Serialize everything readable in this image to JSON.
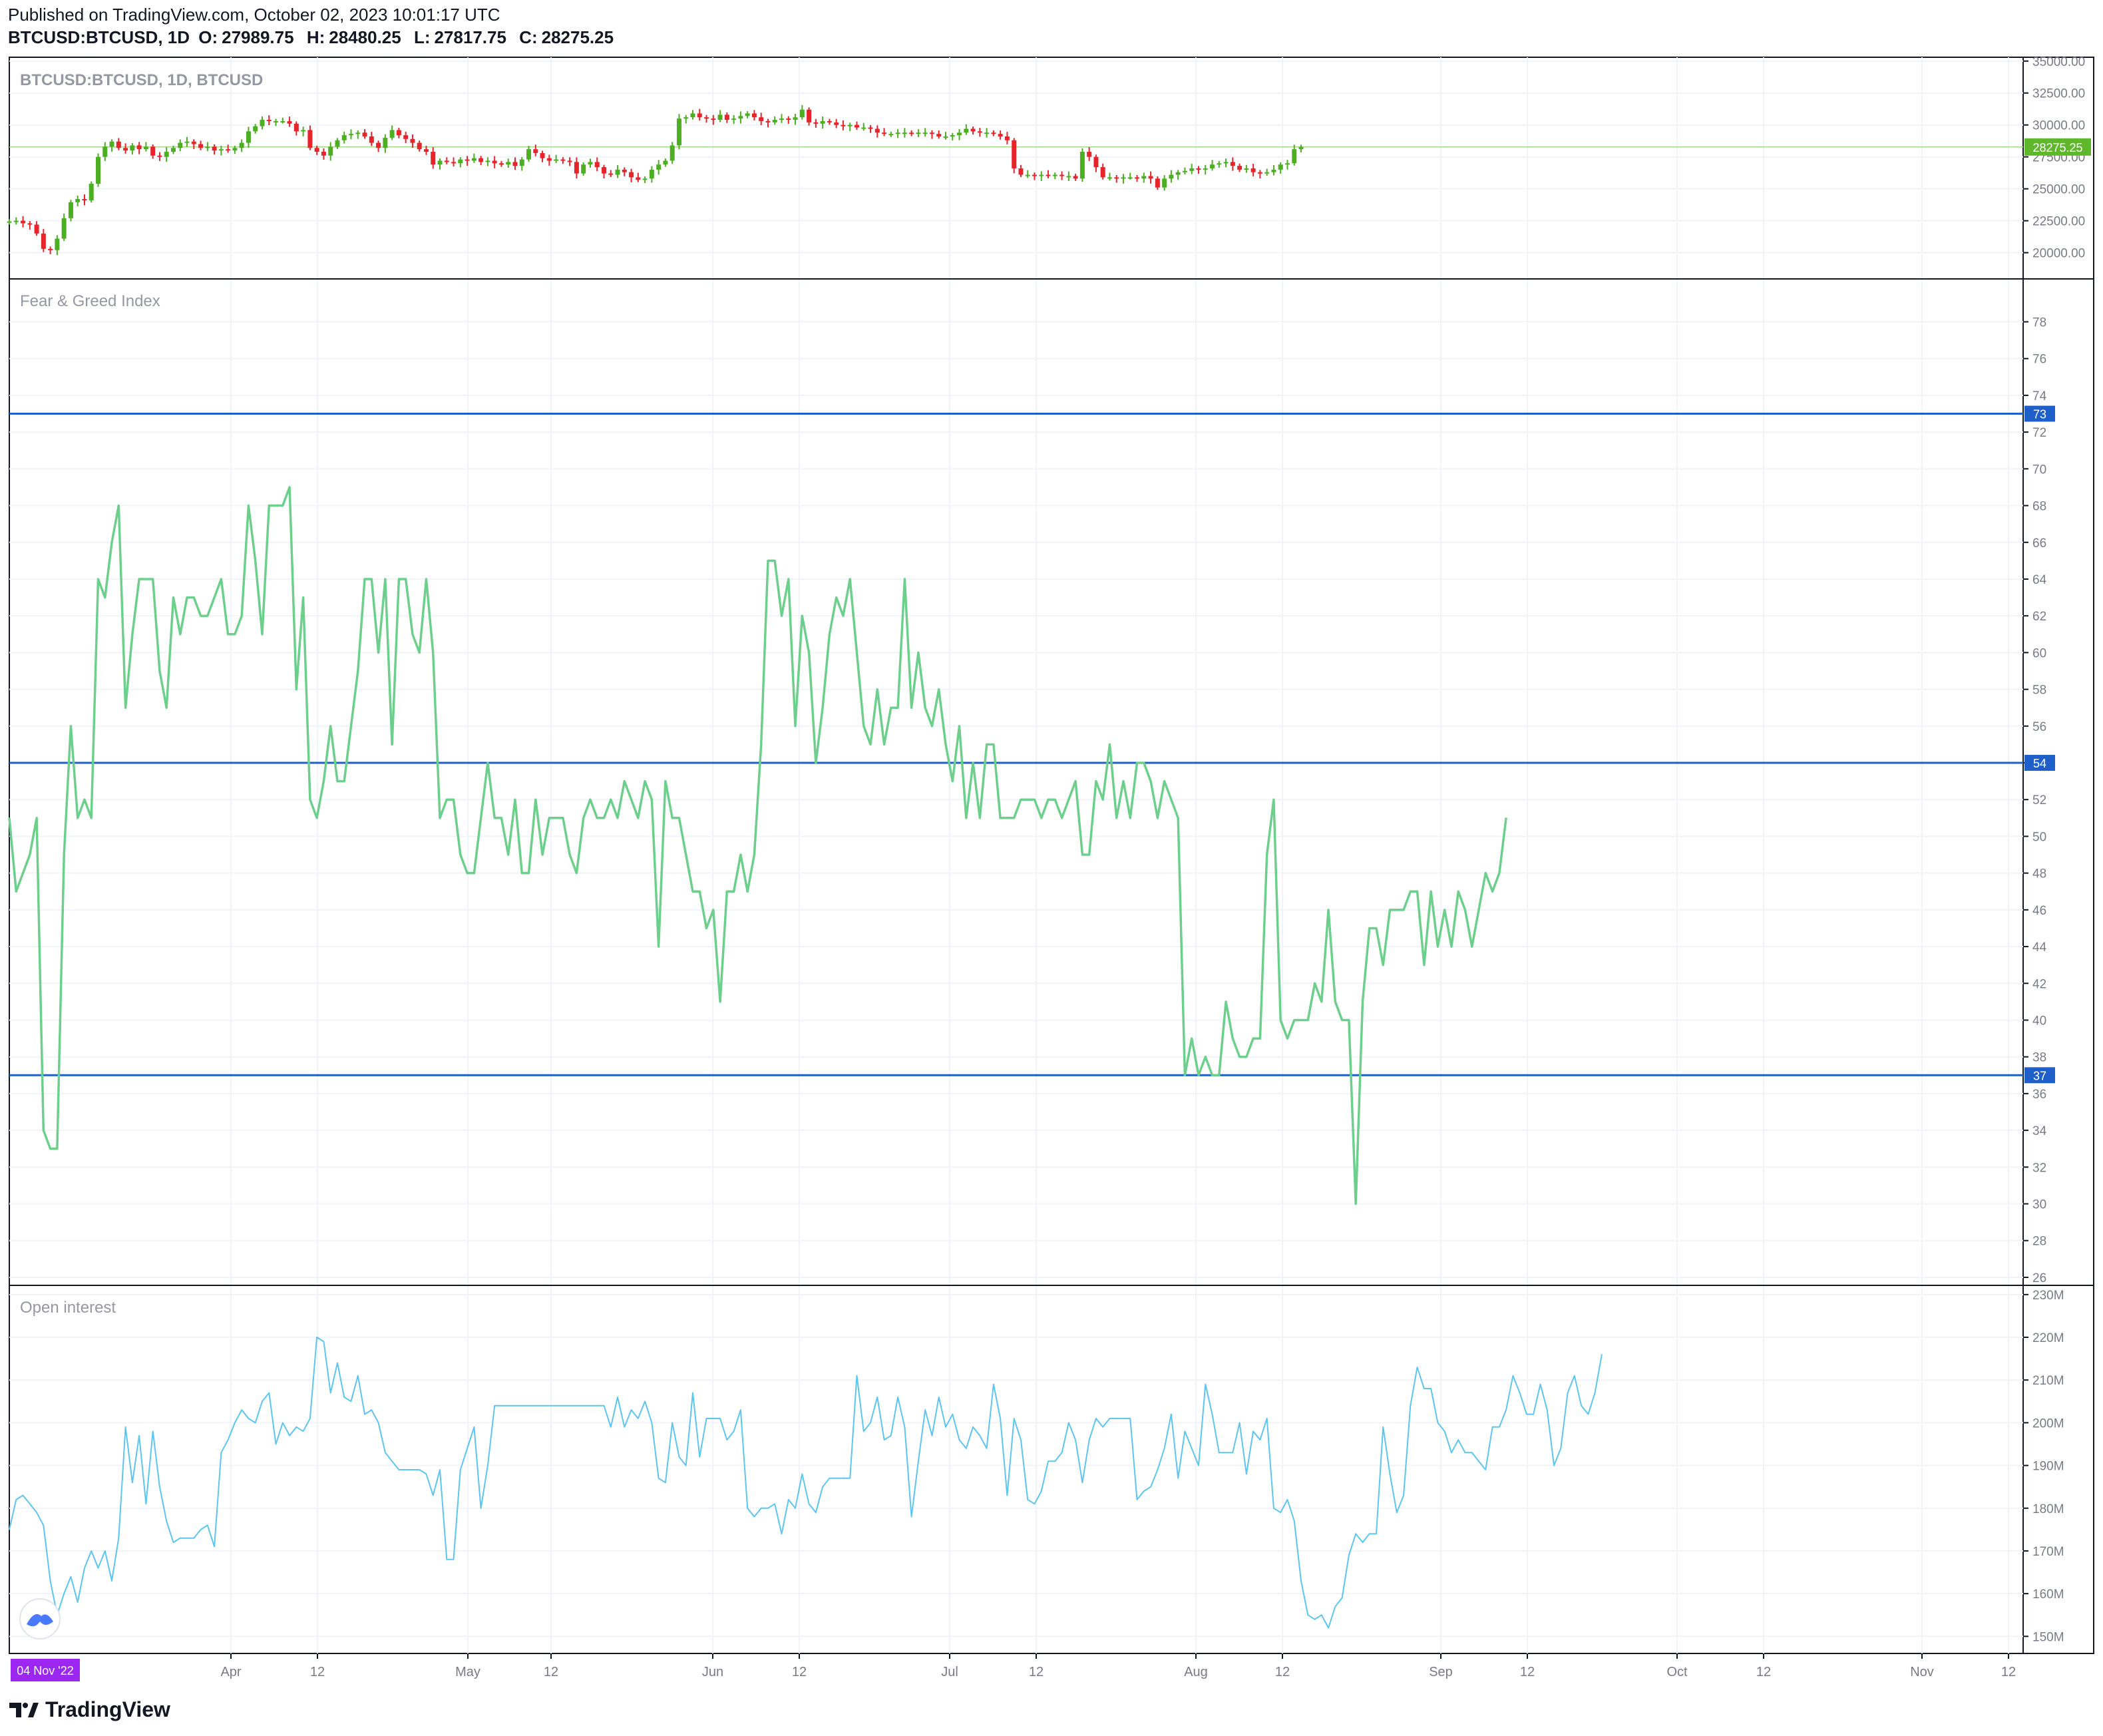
{
  "header": {
    "published": "Published on TradingView.com, October 02, 2023 10:01:17 UTC",
    "symbol": "BTCUSD:BTCUSD, 1D",
    "o_label": "O:",
    "o": "27989.75",
    "h_label": "H:",
    "h": "28480.25",
    "l_label": "L:",
    "l": "27817.75",
    "c_label": "C:",
    "c": "28275.25"
  },
  "footer": {
    "brand": "TradingView"
  },
  "colors": {
    "up": "#4caf22",
    "down": "#e8242b",
    "fg_line": "#6dcf8c",
    "oi_line": "#5cc5f0",
    "hline": "#1f5fc9",
    "grid": "#f0f3fa",
    "price_badge": "#5fb82c",
    "axis_text": "#787b86",
    "date_badge": "#9c27f0"
  },
  "chart_data": [
    {
      "type": "candlestick",
      "title": "BTCUSD:BTCUSD, 1D, BTCUSD",
      "y_ticks": [
        "20000.00",
        "22500.00",
        "25000.00",
        "27500.00",
        "30000.00",
        "32500.00",
        "35000.00"
      ],
      "ylim": [
        18000,
        35300
      ],
      "last_price_label": "28275.25",
      "close_series": [
        22450,
        22500,
        22300,
        22200,
        21500,
        20300,
        20200,
        21100,
        22700,
        23950,
        24200,
        24100,
        25400,
        27500,
        28300,
        28700,
        28200,
        28000,
        28400,
        28100,
        28300,
        27600,
        27500,
        27900,
        28200,
        28600,
        28700,
        28500,
        28200,
        28300,
        28000,
        28100,
        28000,
        28200,
        28600,
        29500,
        29900,
        30400,
        30300,
        30300,
        30300,
        30100,
        29500,
        29600,
        28200,
        27900,
        27600,
        28300,
        28800,
        29200,
        29300,
        29400,
        29100,
        28600,
        28200,
        29000,
        29600,
        29200,
        28900,
        28600,
        28100,
        27900,
        26900,
        27200,
        27100,
        27000,
        27300,
        27200,
        27400,
        27100,
        27200,
        27000,
        26900,
        27100,
        26800,
        27300,
        28100,
        27800,
        27400,
        27200,
        27300,
        27200,
        27100,
        26200,
        26900,
        27100,
        26700,
        26200,
        26100,
        26500,
        26300,
        25900,
        25700,
        25800,
        26500,
        26900,
        27200,
        28400,
        30500,
        30600,
        30900,
        30600,
        30500,
        30400,
        30800,
        30400,
        30500,
        30700,
        30900,
        30600,
        30300,
        30200,
        30400,
        30500,
        30400,
        30600,
        31200,
        30200,
        30100,
        30300,
        30200,
        30000,
        29900,
        30000,
        29800,
        29800,
        29700,
        29400,
        29300,
        29300,
        29400,
        29400,
        29300,
        29400,
        29400,
        29300,
        29100,
        29100,
        29200,
        29400,
        29700,
        29500,
        29400,
        29400,
        29300,
        29100,
        28800,
        26600,
        26100,
        26100,
        26000,
        26100,
        26000,
        26100,
        26000,
        26000,
        25800,
        27900,
        27500,
        26700,
        25900,
        25900,
        25800,
        25900,
        25900,
        25800,
        26000,
        25800,
        25100,
        25800,
        26100,
        26300,
        26400,
        26600,
        26500,
        26600,
        26900,
        27000,
        27100,
        26800,
        26500,
        26600,
        26300,
        26200,
        26300,
        26500,
        26900,
        27000,
        28100,
        28275.25
      ]
    },
    {
      "type": "line",
      "title": "Fear & Greed Index",
      "y_ticks": [
        26,
        28,
        30,
        32,
        34,
        36,
        38,
        40,
        42,
        44,
        46,
        48,
        50,
        52,
        54,
        56,
        58,
        60,
        62,
        64,
        66,
        68,
        70,
        72,
        74,
        76,
        78
      ],
      "ylim": [
        25.6,
        80.3
      ],
      "hlines": [
        73,
        54,
        37
      ],
      "values": [
        51,
        47,
        48,
        49,
        51,
        34,
        33,
        33,
        49,
        56,
        51,
        52,
        51,
        64,
        63,
        66,
        68,
        57,
        61,
        64,
        64,
        64,
        59,
        57,
        63,
        61,
        63,
        63,
        62,
        62,
        63,
        64,
        61,
        61,
        62,
        68,
        65,
        61,
        68,
        68,
        68,
        69,
        58,
        63,
        52,
        51,
        53,
        56,
        53,
        53,
        56,
        59,
        64,
        64,
        60,
        64,
        55,
        64,
        64,
        61,
        60,
        64,
        60,
        51,
        52,
        52,
        49,
        48,
        48,
        51,
        54,
        51,
        51,
        49,
        52,
        48,
        48,
        52,
        49,
        51,
        51,
        51,
        49,
        48,
        51,
        52,
        51,
        51,
        52,
        51,
        53,
        52,
        51,
        53,
        52,
        44,
        53,
        51,
        51,
        49,
        47,
        47,
        45,
        46,
        41,
        47,
        47,
        49,
        47,
        49,
        55,
        65,
        65,
        62,
        64,
        56,
        62,
        60,
        54,
        57,
        61,
        63,
        62,
        64,
        60,
        56,
        55,
        58,
        55,
        57,
        57,
        64,
        57,
        60,
        57,
        56,
        58,
        55,
        53,
        56,
        51,
        54,
        51,
        55,
        55,
        51,
        51,
        51,
        52,
        52,
        52,
        51,
        52,
        52,
        51,
        52,
        53,
        49,
        49,
        53,
        52,
        55,
        51,
        53,
        51,
        54,
        54,
        53,
        51,
        53,
        52,
        51,
        37,
        39,
        37,
        38,
        37,
        37,
        41,
        39,
        38,
        38,
        39,
        39,
        49,
        52,
        40,
        39,
        40,
        40,
        40,
        42,
        41,
        46,
        41,
        40,
        40,
        30,
        41,
        45,
        45,
        43,
        46,
        46,
        46,
        47,
        47,
        43,
        47,
        44,
        46,
        44,
        47,
        46,
        44,
        46,
        48,
        47,
        48,
        51
      ]
    },
    {
      "type": "line",
      "title": "Open interest",
      "y_ticks": [
        "150M",
        "160M",
        "170M",
        "180M",
        "190M",
        "200M",
        "210M",
        "220M",
        "230M"
      ],
      "ylim": [
        146,
        232
      ],
      "values": [
        175,
        182,
        183,
        181,
        179,
        176,
        163,
        155,
        160,
        164,
        158,
        166,
        170,
        166,
        170,
        163,
        173,
        199,
        186,
        197,
        181,
        198,
        185,
        177,
        172,
        173,
        173,
        173,
        175,
        176,
        171,
        193,
        196,
        200,
        203,
        201,
        200,
        205,
        207,
        195,
        200,
        197,
        199,
        198,
        201,
        220,
        219,
        207,
        214,
        206,
        205,
        211,
        202,
        203,
        200,
        193,
        191,
        189,
        189,
        189,
        189,
        188,
        183,
        189,
        168,
        168,
        189,
        194,
        199,
        180,
        190,
        204,
        204,
        204,
        204,
        204,
        204,
        204,
        204,
        204,
        204,
        204,
        204,
        204,
        204,
        204,
        204,
        204,
        199,
        206,
        199,
        203,
        201,
        205,
        200,
        187,
        186,
        200,
        192,
        190,
        207,
        192,
        201,
        201,
        201,
        196,
        198,
        203,
        180,
        178,
        180,
        180,
        181,
        174,
        182,
        180,
        188,
        181,
        179,
        185,
        187,
        187,
        187,
        187,
        211,
        198,
        200,
        206,
        196,
        197,
        206,
        199,
        178,
        191,
        203,
        197,
        206,
        199,
        202,
        196,
        194,
        199,
        197,
        194,
        209,
        201,
        183,
        201,
        196,
        182,
        181,
        184,
        191,
        191,
        193,
        200,
        196,
        186,
        196,
        201,
        199,
        201,
        201,
        201,
        201,
        182,
        184,
        185,
        189,
        194,
        202,
        187,
        198,
        194,
        190,
        209,
        202,
        193,
        193,
        193,
        200,
        188,
        198,
        196,
        201,
        180,
        179,
        182,
        177,
        163,
        155,
        154,
        155,
        152,
        157,
        159,
        169,
        174,
        172,
        174,
        174,
        199,
        188,
        179,
        183,
        204,
        213,
        208,
        208,
        200,
        198,
        193,
        196,
        193,
        193,
        191,
        189,
        199,
        199,
        203,
        211,
        207,
        202,
        202,
        209,
        203,
        190,
        194,
        207,
        211,
        204,
        202,
        207,
        216
      ]
    }
  ],
  "time_axis": {
    "labels": [
      "Apr",
      "12",
      "May",
      "12",
      "Jun",
      "12",
      "Jul",
      "12",
      "Aug",
      "12",
      "Sep",
      "12",
      "Oct",
      "12",
      "Nov",
      "12"
    ],
    "cursor_date": "04 Nov '22"
  },
  "price_axis_badges": {
    "fg_h1": "73",
    "fg_h2": "54",
    "fg_h3": "37"
  }
}
